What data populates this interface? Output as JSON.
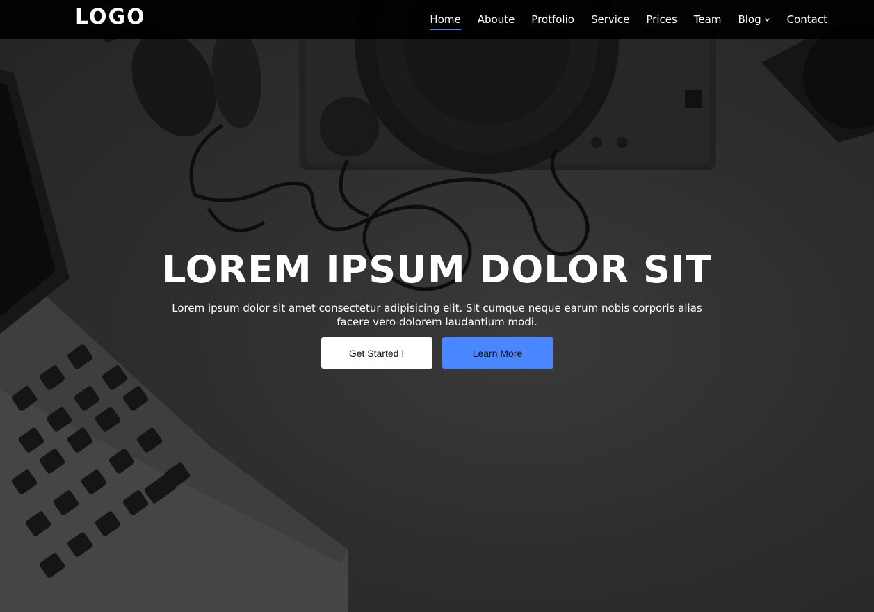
{
  "brand": {
    "logo": "LOGO"
  },
  "nav": {
    "items": [
      {
        "label": "Home",
        "active": true
      },
      {
        "label": "Aboute"
      },
      {
        "label": "Protfolio"
      },
      {
        "label": "Service"
      },
      {
        "label": "Prices"
      },
      {
        "label": "Team"
      },
      {
        "label": "Blog",
        "has_dropdown": true
      },
      {
        "label": "Contact"
      }
    ]
  },
  "hero": {
    "title": "LOREM IPSUM DOLOR SIT",
    "subtitle": "Lorem ipsum dolor sit amet consectetur adipisicing elit. Sit cumque neque earum nobis corporis alias facere vero dolorem laudantium modi.",
    "buttons": {
      "get_started": "Get Started !",
      "learn_more": "Learn More"
    }
  },
  "colors": {
    "accent": "#4a86ff",
    "navbar_bg": "#000000",
    "text": "#ffffff"
  }
}
